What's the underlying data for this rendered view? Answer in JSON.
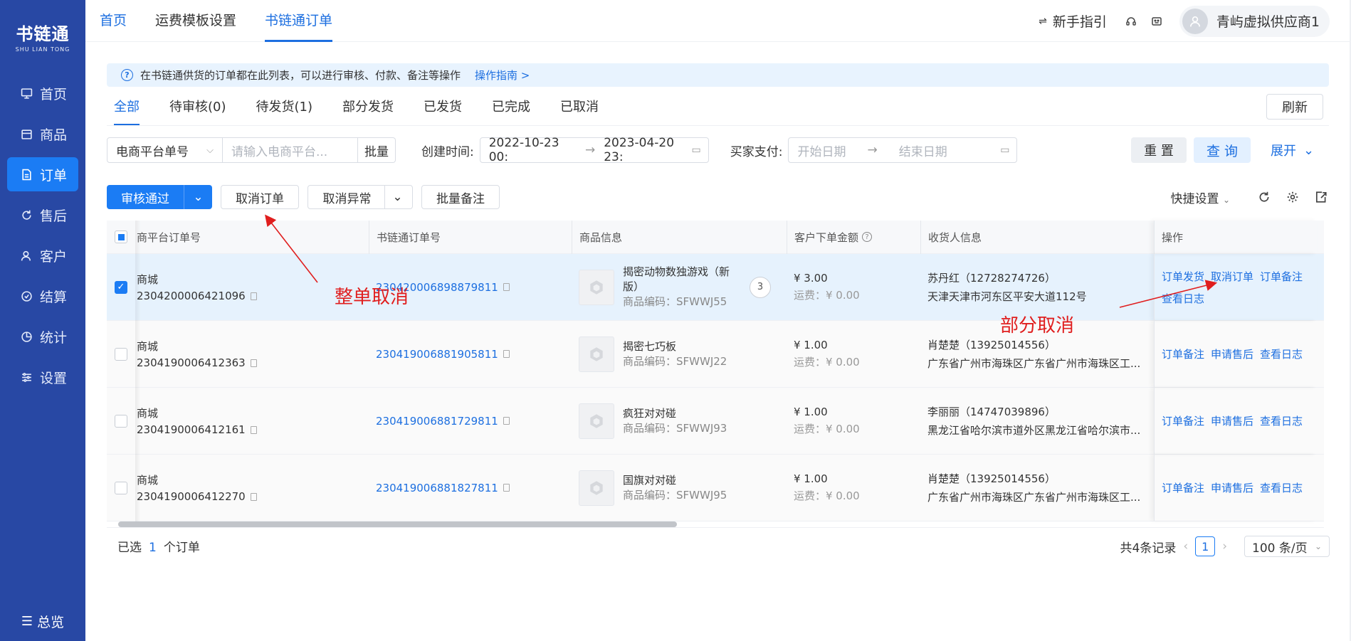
{
  "brand": {
    "name": "书链通",
    "sub": "SHU LIAN TONG"
  },
  "sidebar": {
    "items": [
      {
        "label": "首页",
        "icon": "monitor-icon"
      },
      {
        "label": "商品",
        "icon": "box-icon"
      },
      {
        "label": "订单",
        "icon": "document-icon",
        "active": true
      },
      {
        "label": "售后",
        "icon": "refresh-icon"
      },
      {
        "label": "客户",
        "icon": "user-icon"
      },
      {
        "label": "结算",
        "icon": "settle-icon"
      },
      {
        "label": "统计",
        "icon": "pie-icon"
      },
      {
        "label": "设置",
        "icon": "sliders-icon"
      }
    ],
    "overview": "总览"
  },
  "header": {
    "tabs": [
      "首页",
      "运费模板设置",
      "书链通订单"
    ],
    "active_tab": "书链通订单",
    "guide": "新手指引",
    "user": "青屿虚拟供应商1"
  },
  "banner": {
    "text": "在书链通供货的订单都在此列表，可以进行审核、付款、备注等操作",
    "link": "操作指南 >"
  },
  "status_tabs": [
    "全部",
    "待审核(0)",
    "待发货(1)",
    "部分发货",
    "已发货",
    "已完成",
    "已取消"
  ],
  "refresh": "刷新",
  "filters": {
    "field_select": "电商平台单号",
    "input_placeholder": "请输入电商平台...",
    "batch": "批量",
    "created_label": "创建时间:",
    "created_from": "2022-10-23 00:",
    "created_to": "2023-04-20 23:",
    "paid_label": "买家支付:",
    "paid_from": "开始日期",
    "paid_to": "结束日期",
    "reset": "重 置",
    "query": "查 询",
    "expand": "展开"
  },
  "actions": {
    "approve": "审核通过",
    "cancel_order": "取消订单",
    "cancel_abnormal": "取消异常",
    "batch_note": "批量备注",
    "quick_settings": "快捷设置"
  },
  "table": {
    "headers": [
      "商平台订单号",
      "书链通订单号",
      "商品信息",
      "客户下单金额",
      "收货人信息",
      "操作"
    ],
    "rows": [
      {
        "selected": true,
        "platform": "商城",
        "platform_no": "2304200006421096",
        "slt_no": "230420006898879811",
        "goods_name": "揭密动物数独游戏（新版）",
        "goods_code": "商品编码：SFWWJ55",
        "qty": "3",
        "amount": "¥ 3.00",
        "fee": "运费：¥ 0.00",
        "recv_name": "苏丹红（12728274726）",
        "recv_addr": "天津天津市河东区平安大道112号",
        "ops": [
          "订单发货",
          "取消订单",
          "订单备注",
          "查看日志"
        ]
      },
      {
        "selected": false,
        "platform": "商城",
        "platform_no": "2304190006412363",
        "slt_no": "230419006881905811",
        "goods_name": "揭密七巧板",
        "goods_code": "商品编码：SFWWJ22",
        "qty": "",
        "amount": "¥ 1.00",
        "fee": "运费：¥ 0.00",
        "recv_name": "肖楚楚（13925014556）",
        "recv_addr": "广东省广州市海珠区广东省广州市海珠区工...",
        "ops": [
          "订单备注",
          "申请售后",
          "查看日志"
        ]
      },
      {
        "selected": false,
        "platform": "商城",
        "platform_no": "2304190006412161",
        "slt_no": "230419006881729811",
        "goods_name": "疯狂对对碰",
        "goods_code": "商品编码：SFWWJ93",
        "qty": "",
        "amount": "¥ 1.00",
        "fee": "运费：¥ 0.00",
        "recv_name": "李丽丽（14747039896）",
        "recv_addr": "黑龙江省哈尔滨市道外区黑龙江省哈尔滨市...",
        "ops": [
          "订单备注",
          "申请售后",
          "查看日志"
        ]
      },
      {
        "selected": false,
        "platform": "商城",
        "platform_no": "2304190006412270",
        "slt_no": "230419006881827811",
        "goods_name": "国旗对对碰",
        "goods_code": "商品编码：SFWWJ95",
        "qty": "",
        "amount": "¥ 1.00",
        "fee": "运费：¥ 0.00",
        "recv_name": "肖楚楚（13925014556）",
        "recv_addr": "广东省广州市海珠区广东省广州市海珠区工...",
        "ops": [
          "订单备注",
          "申请售后",
          "查看日志"
        ]
      }
    ]
  },
  "footer": {
    "selected_prefix": "已选",
    "selected_count": "1",
    "selected_suffix": "个订单",
    "total": "共4条记录",
    "page": "1",
    "page_size": "100 条/页"
  },
  "annotations": {
    "whole_cancel": "整单取消",
    "partial_cancel": "部分取消"
  },
  "colors": {
    "sidebar_bg": "#2848a4",
    "primary": "#1b7cf4",
    "annotation": "#e01e1e"
  }
}
